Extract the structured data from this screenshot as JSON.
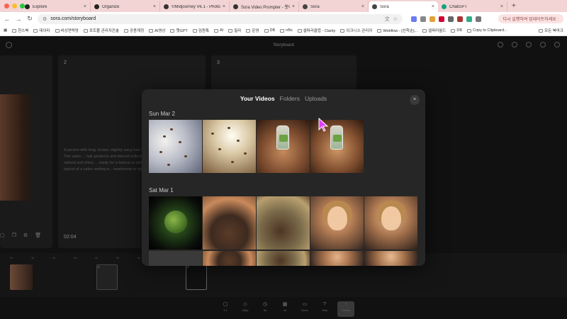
{
  "browser": {
    "tabs": [
      {
        "label": "Explore",
        "active": false
      },
      {
        "label": "Organize",
        "active": false
      },
      {
        "label": "©Midjourney V6.1 - Photorea",
        "active": false
      },
      {
        "label": "Sora Video Prompter - 챗의 ...",
        "active": false
      },
      {
        "label": "Sora",
        "active": false
      },
      {
        "label": "Sora",
        "active": true
      },
      {
        "label": "ChatGPT",
        "active": false
      }
    ],
    "url": "sora.com/storyboard",
    "update_button": "다시 실행하여 업데이트하세요 :",
    "bookmarks": [
      "한스북",
      "데이터",
      "비상연락망",
      "포트폴 관리자콘솔",
      "공용계정",
      "AI영상",
      "챗GPT",
      "임원톡",
      "AI",
      "필라",
      "운영",
      "DB",
      "nBs",
      "셀퍼러클럽 - Clarity",
      "이크니스 관리자",
      "Webflow - [선착순]...",
      "셀퍼러월드",
      "DB",
      "Copy to Clipboard..."
    ],
    "bookmarks_right": "모든 북마크"
  },
  "app": {
    "title": "Storyboard",
    "cards": [
      {
        "number": "",
        "time": ""
      },
      {
        "number": "2",
        "description": "A person with long, brown, slightly wavy hair facing away from the camera. The salon ... hair products and blurred reflections of ... The person's hair looks natural and shiny ... ready for a haircut or styling session. The ... professional, typical of a salon setting w... treatments or styling.",
        "time": "02:04"
      },
      {
        "number": "3"
      }
    ],
    "timeline_marks": [
      "0s",
      "1s",
      "2s",
      "3s",
      "4s",
      "5s",
      "6s",
      "7s",
      "8s",
      "9s",
      "10s",
      "11s",
      "12s",
      "13s",
      "14s",
      "15s"
    ],
    "timeline_clip_numbers": [
      "1",
      "2",
      "3"
    ],
    "dock": [
      {
        "icon": "▢",
        "label": "1:1"
      },
      {
        "icon": "◇",
        "label": "480p"
      },
      {
        "icon": "◷",
        "label": "5s"
      },
      {
        "icon": "▦",
        "label": "4v"
      },
      {
        "icon": "▭",
        "label": "None"
      },
      {
        "icon": "?",
        "label": "Help"
      },
      {
        "icon": "↑",
        "label": "Create"
      }
    ]
  },
  "modal": {
    "tabs": [
      {
        "label": "Your Videos",
        "active": true
      },
      {
        "label": "Folders",
        "active": false
      },
      {
        "label": "Uploads",
        "active": false
      }
    ],
    "close_label": "×",
    "groups": [
      {
        "date": "Sun Mar 2",
        "thumbnails": [
          "sky-seeds-thumbnail",
          "sky-sun-seeds-thumbnail",
          "hands-bottle-thumbnail",
          "hands-bottle-thumbnail-2"
        ]
      },
      {
        "date": "Sat Mar 1",
        "thumbnails": [
          "broccoli-planet-thumbnail",
          "wok-pan-thumbnail",
          "wok-pan-thumbnail-2",
          "smiling-woman-thumbnail",
          "smiling-woman-thumbnail-2"
        ]
      }
    ]
  },
  "colors": {
    "tabbar_bg": "#f2d4d4",
    "app_bg": "#111111",
    "modal_bg": "#262626",
    "cursor": "#e040fb"
  }
}
